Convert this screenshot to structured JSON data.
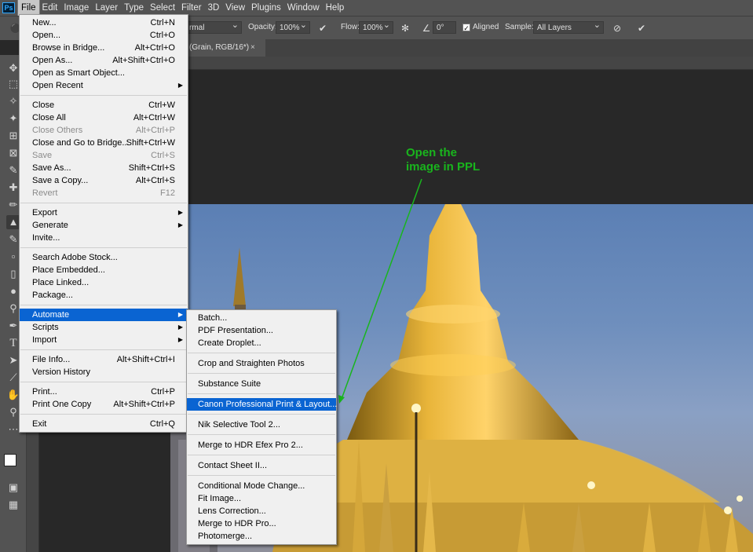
{
  "menubar": {
    "logo": "Ps",
    "items": [
      "File",
      "Edit",
      "Image",
      "Layer",
      "Type",
      "Select",
      "Filter",
      "3D",
      "View",
      "Plugins",
      "Window",
      "Help"
    ]
  },
  "options": {
    "mode": "rmal",
    "opacity_label": "Opacity:",
    "opacity_value": "100%",
    "flow_label": "Flow:",
    "flow_value": "100%",
    "angle_value": "0°",
    "aligned_label": "Aligned",
    "sample_label": "Sample:",
    "sample_value": "All Layers"
  },
  "document": {
    "tab_title": "(Grain, RGB/16*)",
    "close": "×"
  },
  "file_menu": {
    "groups": [
      [
        {
          "label": "New...",
          "shortcut": "Ctrl+N"
        },
        {
          "label": "Open...",
          "shortcut": "Ctrl+O"
        },
        {
          "label": "Browse in Bridge...",
          "shortcut": "Alt+Ctrl+O"
        },
        {
          "label": "Open As...",
          "shortcut": "Alt+Shift+Ctrl+O"
        },
        {
          "label": "Open as Smart Object...",
          "shortcut": ""
        },
        {
          "label": "Open Recent",
          "shortcut": "",
          "submenu": true
        }
      ],
      [
        {
          "label": "Close",
          "shortcut": "Ctrl+W"
        },
        {
          "label": "Close All",
          "shortcut": "Alt+Ctrl+W"
        },
        {
          "label": "Close Others",
          "shortcut": "Alt+Ctrl+P",
          "disabled": true
        },
        {
          "label": "Close and Go to Bridge...",
          "shortcut": "Shift+Ctrl+W"
        },
        {
          "label": "Save",
          "shortcut": "Ctrl+S",
          "disabled": true
        },
        {
          "label": "Save As...",
          "shortcut": "Shift+Ctrl+S"
        },
        {
          "label": "Save a Copy...",
          "shortcut": "Alt+Ctrl+S"
        },
        {
          "label": "Revert",
          "shortcut": "F12",
          "disabled": true
        }
      ],
      [
        {
          "label": "Export",
          "shortcut": "",
          "submenu": true
        },
        {
          "label": "Generate",
          "shortcut": "",
          "submenu": true
        },
        {
          "label": "Invite...",
          "shortcut": ""
        }
      ],
      [
        {
          "label": "Search Adobe Stock...",
          "shortcut": ""
        },
        {
          "label": "Place Embedded...",
          "shortcut": ""
        },
        {
          "label": "Place Linked...",
          "shortcut": ""
        },
        {
          "label": "Package...",
          "shortcut": ""
        }
      ],
      [
        {
          "label": "Automate",
          "shortcut": "",
          "submenu": true,
          "highlighted": true
        },
        {
          "label": "Scripts",
          "shortcut": "",
          "submenu": true
        },
        {
          "label": "Import",
          "shortcut": "",
          "submenu": true
        }
      ],
      [
        {
          "label": "File Info...",
          "shortcut": "Alt+Shift+Ctrl+I"
        },
        {
          "label": "Version History",
          "shortcut": ""
        }
      ],
      [
        {
          "label": "Print...",
          "shortcut": "Ctrl+P"
        },
        {
          "label": "Print One Copy",
          "shortcut": "Alt+Shift+Ctrl+P"
        }
      ],
      [
        {
          "label": "Exit",
          "shortcut": "Ctrl+Q"
        }
      ]
    ]
  },
  "automate_menu": {
    "groups": [
      [
        {
          "label": "Batch..."
        },
        {
          "label": "PDF Presentation..."
        },
        {
          "label": "Create Droplet..."
        }
      ],
      [
        {
          "label": "Crop and Straighten Photos"
        }
      ],
      [
        {
          "label": "Substance Suite"
        }
      ],
      [
        {
          "label": "Canon Professional Print & Layout...",
          "highlighted": true
        }
      ],
      [
        {
          "label": "Nik Selective Tool 2..."
        }
      ],
      [
        {
          "label": "Merge to HDR Efex Pro 2..."
        }
      ],
      [
        {
          "label": "Contact Sheet II..."
        }
      ],
      [
        {
          "label": "Conditional Mode Change..."
        },
        {
          "label": "Fit Image..."
        },
        {
          "label": "Lens Correction..."
        },
        {
          "label": "Merge to HDR Pro..."
        },
        {
          "label": "Photomerge..."
        }
      ]
    ]
  },
  "annotation": {
    "line1": "Open the",
    "line2": "image in PPL",
    "color": "#19b51d"
  },
  "tools": [
    "move-icon",
    "marquee-icon",
    "lasso-icon",
    "magic-wand-icon",
    "crop-icon",
    "frame-icon",
    "eyedropper-icon",
    "healing-icon",
    "brush-icon",
    "clone-stamp-icon",
    "history-brush-icon",
    "eraser-icon",
    "paint-bucket-icon",
    "blur-icon",
    "dodge-icon",
    "pen-icon",
    "type-icon",
    "path-select-icon",
    "line-icon",
    "hand-icon",
    "zoom-icon",
    "more-icon"
  ]
}
